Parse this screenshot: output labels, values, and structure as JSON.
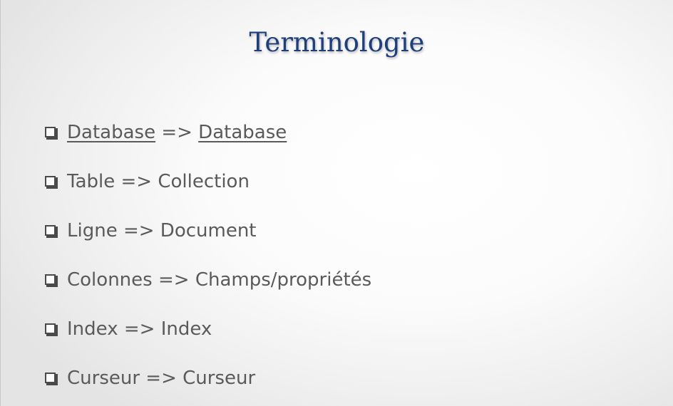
{
  "slide": {
    "title": "Terminologie",
    "items": [
      {
        "left": "Database",
        "arrow": " => ",
        "right": "Database"
      },
      {
        "left": "Table",
        "arrow": " => ",
        "right": "Collection"
      },
      {
        "left": "Ligne",
        "arrow": " => ",
        "right": "Document"
      },
      {
        "left": "Colonnes",
        "arrow": " => ",
        "right": "Champs/propriétés"
      },
      {
        "left": "Index",
        "arrow": " => ",
        "right": "Index"
      },
      {
        "left": "Curseur",
        "arrow": " => ",
        "right": "Curseur"
      }
    ]
  },
  "colors": {
    "title": "#1f3f7a",
    "text": "#5a5a5a",
    "spellcheck": "#d63a3a"
  }
}
